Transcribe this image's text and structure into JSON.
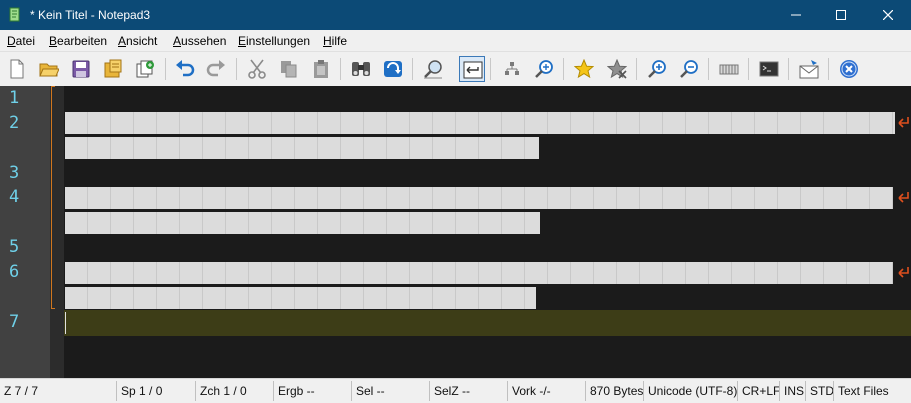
{
  "window": {
    "title": "* Kein Titel - Notepad3"
  },
  "menu": [
    {
      "ul": "D",
      "rest": "atei"
    },
    {
      "ul": "B",
      "rest": "earbeiten"
    },
    {
      "ul": "A",
      "rest": "nsicht"
    },
    {
      "ul": "A",
      "rest": "ussehen"
    },
    {
      "ul": "E",
      "rest": "instellungen"
    },
    {
      "ul": "H",
      "rest": "ilfe"
    }
  ],
  "toolbar": {
    "icons": [
      "new-file-icon",
      "open-folder-icon",
      "save-icon",
      "save-as-icon",
      "copy-to-new-icon",
      "undo-icon",
      "redo-icon",
      "cut-icon",
      "copy-icon",
      "paste-icon",
      "find-icon",
      "replace-icon",
      "goto-icon",
      "word-wrap-icon",
      "fold-icon",
      "zoom-fit-icon",
      "bookmark-icon",
      "clear-bookmarks-icon",
      "zoom-in-icon",
      "zoom-out-icon",
      "column-select-icon",
      "open-console-icon",
      "send-mail-icon",
      "exit-icon"
    ],
    "word_wrap_active": true
  },
  "editor": {
    "line_numbers": [
      "1",
      "2",
      "3",
      "4",
      "5",
      "6",
      "7"
    ],
    "selection_color": "#dcdcdc",
    "current_line_color": "#3d3d17",
    "wrap_marker_color": "#e0501e",
    "line_number_color": "#6fd0e8"
  },
  "status": {
    "line": "Z  7 / 7",
    "col": "Sp  1 / 0",
    "char": "Zch  1 / 0",
    "match": "Ergb  --",
    "sel": "Sel  --",
    "selz": "SelZ  --",
    "occ": "Vork  -/-",
    "size": "870 Bytes",
    "encoding": "Unicode (UTF-8)",
    "eol": "CR+LF",
    "ins": "INS",
    "std": "STD",
    "lexer": "Text Files"
  }
}
